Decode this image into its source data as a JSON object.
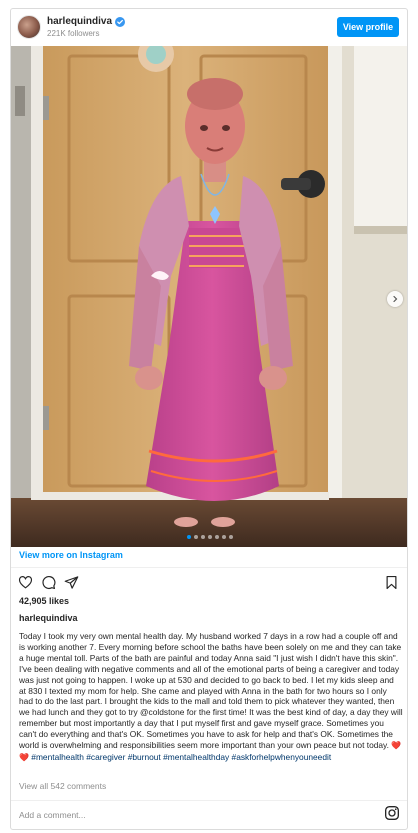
{
  "header": {
    "username": "harlequindiva",
    "followers": "221K followers",
    "view_profile_label": "View profile"
  },
  "post": {
    "carousel": {
      "total_slides": 7,
      "active_slide": 1
    },
    "view_more_label": "View more on Instagram",
    "likes": "42,905 likes",
    "caption_user": "harlequindiva",
    "caption_text": "Today I took my very own mental health day. My husband worked 7 days in a row had a couple off and is working another 7. Every morning before school the baths have been solely on me and they can take a huge mental toll. Parts of the bath are painful and today Anna said \"I just wish I didn't have this skin\". I've been dealing with negative comments and all of the emotional parts of being a caregiver and today was just not going to happen. I woke up at 530 and decided to go back to bed. I let my kids sleep and at 830 I texted my mom for help. She came and played with Anna in the bath for two hours so I only had to do the last part. I brought the kids to the mall and told them to pick whatever they wanted, then we had lunch and they got to try @coldstone for the first time! It was the best kind of day, a day they will remember but most importantly a day that I put myself first and gave myself grace. Sometimes you can't do everything and that's OK. Sometimes you have to ask for help and that's OK. Sometimes the world is overwhelming and responsibilities seem more important than your own peace but not today.",
    "caption_emoji": "❤️❤️",
    "hashtag_1": "#mentalhealth",
    "hashtag_2": "#caregiver",
    "hashtag_3": "#burnout",
    "hashtag_4": "#mentalhealthday",
    "hashtag_5": "#askforhelpwhenyouneedit",
    "view_comments_label": "View all 542 comments",
    "add_comment_placeholder": "Add a comment..."
  },
  "icons": {
    "like": "heart-icon",
    "comment": "comment-icon",
    "share": "share-icon",
    "save": "bookmark-icon",
    "next": "chevron-right-icon",
    "logo": "instagram-icon",
    "verified": "verified-badge-icon"
  },
  "colors": {
    "accent": "#0095f6",
    "hashtag": "#00376b",
    "muted": "#8e8e8e",
    "text": "#262626"
  }
}
